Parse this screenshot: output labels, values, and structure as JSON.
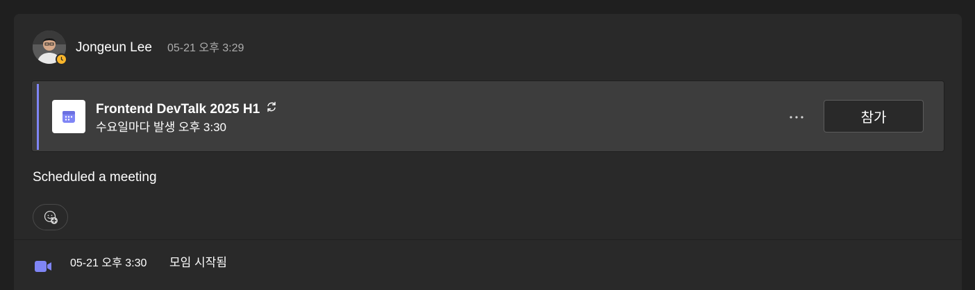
{
  "post": {
    "author": "Jongeun Lee",
    "timestamp": "05-21 오후 3:29",
    "presence": "away",
    "message": "Scheduled a meeting"
  },
  "meeting_card": {
    "title": "Frontend DevTalk 2025 H1",
    "recurrence_icon": "repeat-icon",
    "schedule": "수요일마다 발생 오후 3:30",
    "more_label": "···",
    "join_label": "참가",
    "accent_color": "#7f85f5"
  },
  "event": {
    "timestamp": "05-21 오후 3:30",
    "text": "모임 시작됨",
    "icon": "video-camera-icon",
    "icon_color": "#7f85f5"
  },
  "colors": {
    "background": "#1f1f1f",
    "thread": "#292929",
    "card": "#3d3d3d",
    "presence_away": "#f8b52b"
  }
}
